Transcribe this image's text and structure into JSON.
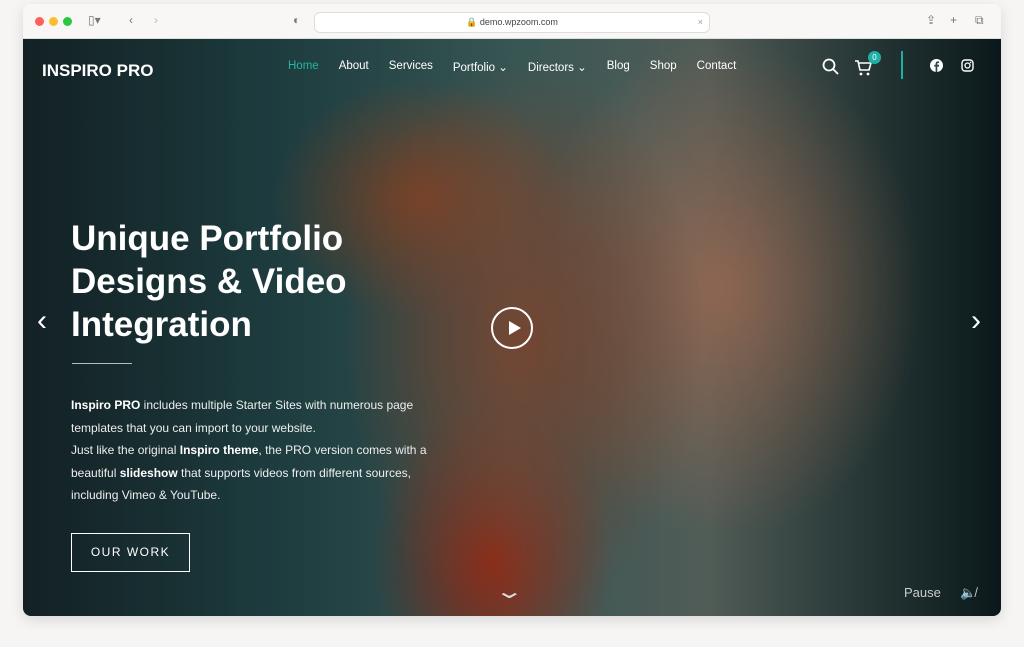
{
  "browser": {
    "url": "demo.wpzoom.com"
  },
  "site": {
    "logo": "INSPIRO PRO",
    "nav": [
      "Home",
      "About",
      "Services",
      "Portfolio",
      "Directors",
      "Blog",
      "Shop",
      "Contact"
    ],
    "cart_count": "0",
    "accent": "#1fb0a5"
  },
  "hero": {
    "title": "Unique Portfolio Designs & Video Integration",
    "desc": [
      [
        "Inspiro PRO",
        " includes multiple Starter Sites with numerous page templates that you can import to your website."
      ],
      [
        "Just like the original ",
        "Inspiro theme",
        ", the PRO version comes with a beautiful ",
        "slideshow",
        " that supports videos from different sources, including Vimeo & YouTube."
      ]
    ],
    "button": "OUR WORK",
    "pause": "Pause"
  }
}
